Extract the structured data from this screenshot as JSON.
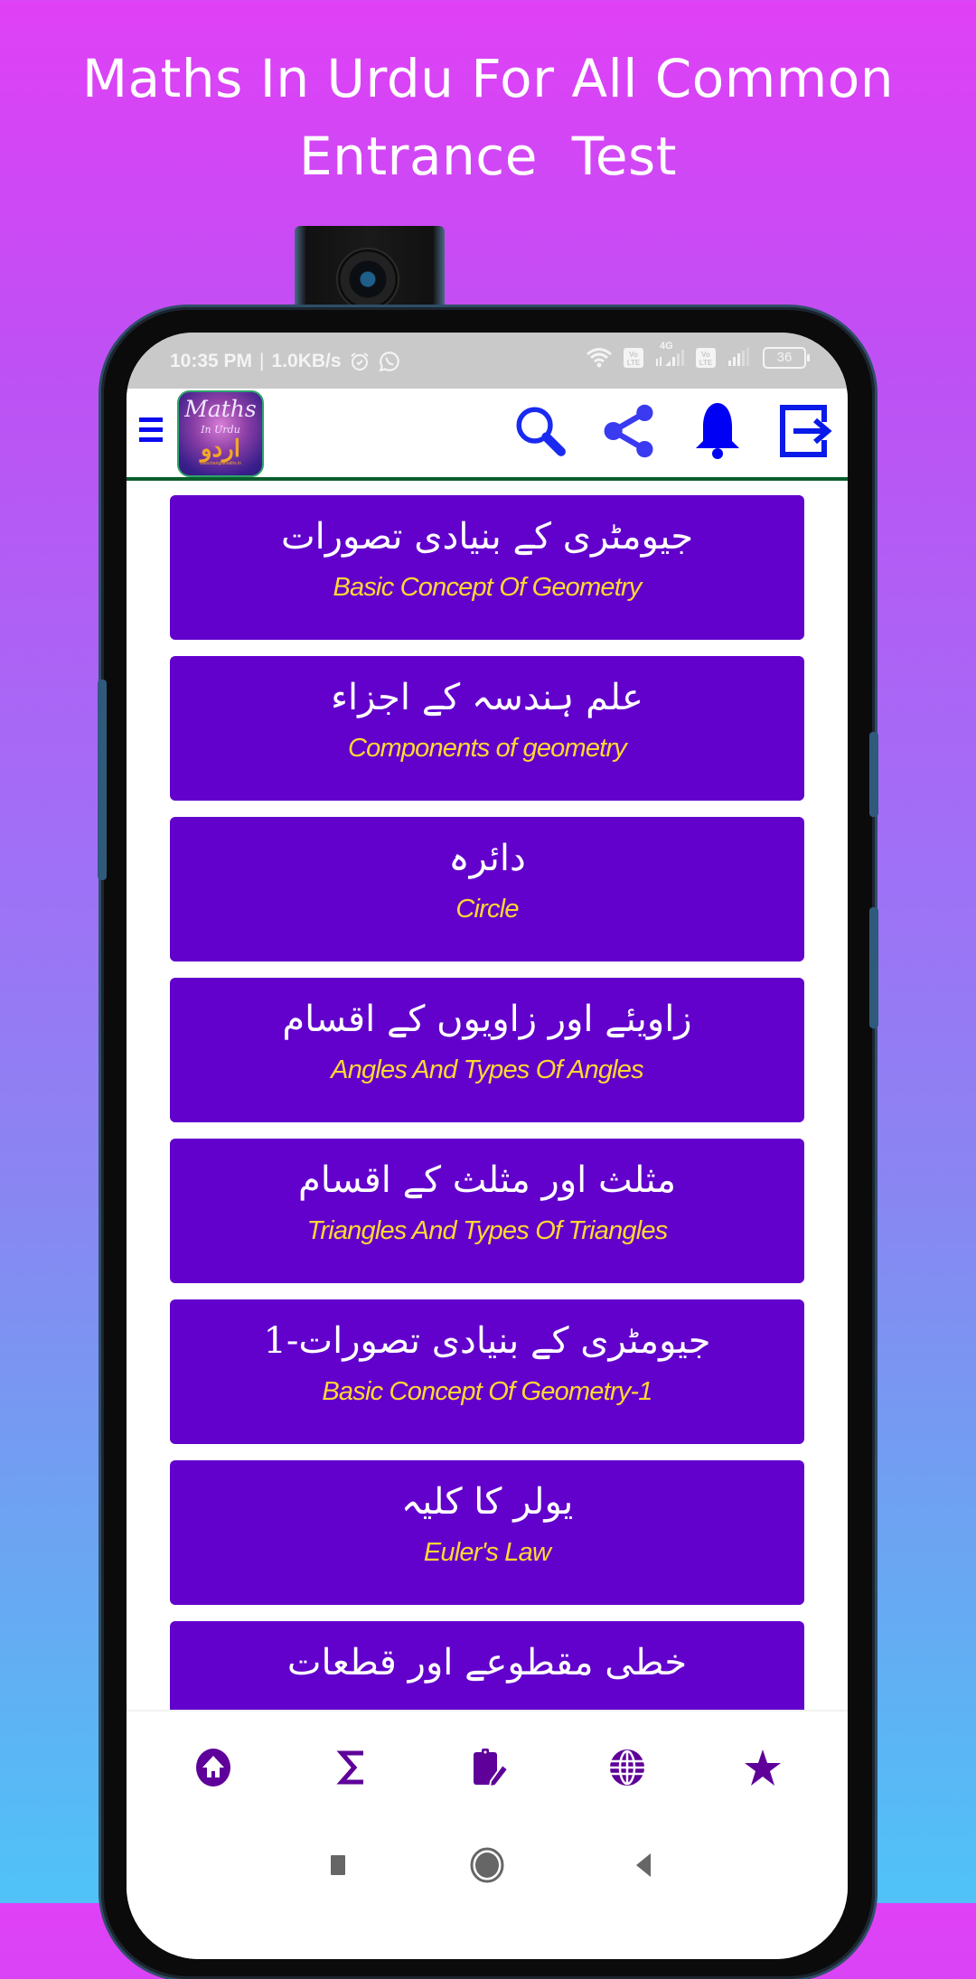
{
  "promo": {
    "title_line1": "Maths In Urdu For All Common",
    "title_line2": "Entrance  Test"
  },
  "status_bar": {
    "time": "10:35 PM",
    "separator": "|",
    "net_speed": "1.0KB/s",
    "left_icons": [
      "alarm-icon",
      "whatsapp-icon"
    ],
    "right_icons": [
      "wifi-icon",
      "volte-icon",
      "signal-4g-icon",
      "volte-icon",
      "signal-icon",
      "battery-icon"
    ],
    "volte_label_top": "Vo",
    "volte_label_bottom": "LTE",
    "network_type": "4G",
    "battery_level": "36"
  },
  "app_bar": {
    "menu_icon": "hamburger-menu-icon",
    "logo": {
      "line1": "Maths",
      "line2": "In Urdu",
      "line3": "اردو",
      "line4": "www.banglamaths.in"
    },
    "actions": [
      {
        "name": "search",
        "icon": "search-icon"
      },
      {
        "name": "share",
        "icon": "share-icon"
      },
      {
        "name": "notifications",
        "icon": "bell-icon"
      },
      {
        "name": "exit",
        "icon": "exit-icon"
      }
    ],
    "accent_color": "#0a0af0",
    "divider_color": "#0b5e2e"
  },
  "topics": [
    {
      "urdu": "جیومٹری کے بنیادی تصورات",
      "english": "Basic Concept Of Geometry"
    },
    {
      "urdu": "علم ہندسہ کے اجزاء",
      "english": "Components of geometry"
    },
    {
      "urdu": "دائرہ",
      "english": "Circle"
    },
    {
      "urdu": "زاویئے اور زاویوں کے اقسام",
      "english": "Angles And Types Of Angles"
    },
    {
      "urdu": "مثلث اور مثلث کے اقسام",
      "english": "Triangles And Types Of Triangles"
    },
    {
      "urdu": "جیومٹری کے بنیادی تصورات-1",
      "english": "Basic Concept Of Geometry-1"
    },
    {
      "urdu": "یولر کا کلیہ",
      "english": "Euler's Law"
    },
    {
      "urdu": "خطی مقطوعے اور قطعات",
      "english": ""
    }
  ],
  "colors": {
    "card_bg": "#6200cc",
    "card_urdu_text": "#ffffff",
    "card_english_text": "#ffd833",
    "bottom_nav_icon": "#5e0099",
    "gradient_top": "#e040f6",
    "gradient_bottom": "#4fc3f7"
  },
  "bottom_nav": [
    {
      "name": "home",
      "icon": "home-icon"
    },
    {
      "name": "formulas",
      "icon": "sigma-icon"
    },
    {
      "name": "notes",
      "icon": "clipboard-edit-icon"
    },
    {
      "name": "web",
      "icon": "globe-icon"
    },
    {
      "name": "favorites",
      "icon": "star-icon"
    }
  ],
  "system_nav": [
    {
      "name": "recents",
      "icon": "square-icon"
    },
    {
      "name": "home",
      "icon": "circle-icon"
    },
    {
      "name": "back",
      "icon": "triangle-back-icon"
    }
  ]
}
